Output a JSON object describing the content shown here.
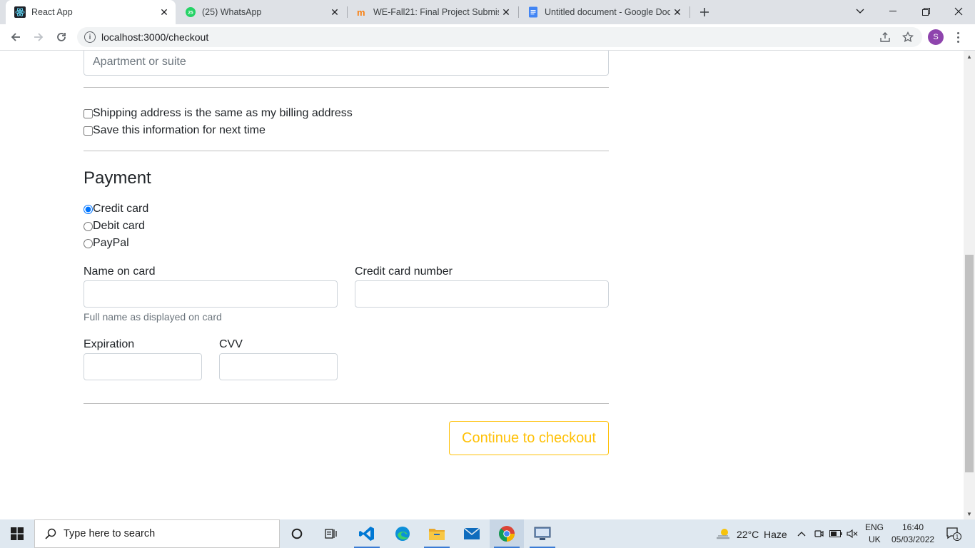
{
  "browser": {
    "tabs": [
      {
        "title": "React App",
        "active": true
      },
      {
        "title": "(25) WhatsApp",
        "active": false,
        "badge": "25"
      },
      {
        "title": "WE-Fall21: Final Project Submissi",
        "active": false
      },
      {
        "title": "Untitled document - Google Doc",
        "active": false
      }
    ],
    "url": "localhost:3000/checkout",
    "profile_initial": "S"
  },
  "form": {
    "apartment_placeholder": "Apartment or suite",
    "same_address_label": "Shipping address is the same as my billing address",
    "save_info_label": "Save this information for next time",
    "payment_heading": "Payment",
    "payment_methods": [
      {
        "label": "Credit card",
        "checked": true
      },
      {
        "label": "Debit card",
        "checked": false
      },
      {
        "label": "PayPal",
        "checked": false
      }
    ],
    "name_on_card_label": "Name on card",
    "name_on_card_help": "Full name as displayed on card",
    "card_number_label": "Credit card number",
    "expiration_label": "Expiration",
    "cvv_label": "CVV",
    "checkout_button": "Continue to checkout"
  },
  "taskbar": {
    "search_placeholder": "Type here to search",
    "weather_temp": "22°C",
    "weather_text": "Haze",
    "language": "ENG",
    "region": "UK",
    "time": "16:40",
    "date": "05/03/2022",
    "notification_count": "1"
  },
  "colors": {
    "accent_warning": "#ffc107",
    "chrome_tabstrip": "#dee1e6",
    "taskbar": "#dfe8f0"
  }
}
